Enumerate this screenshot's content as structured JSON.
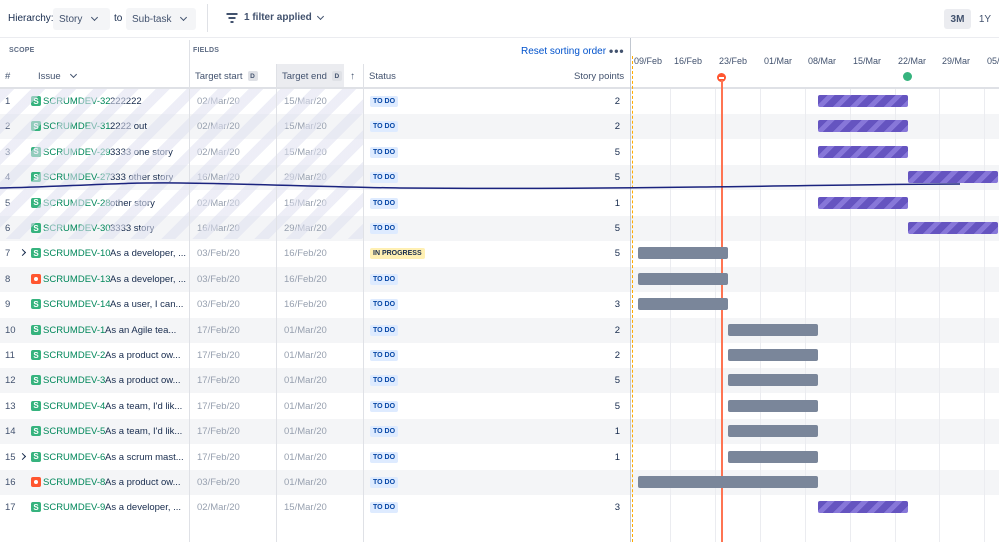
{
  "toolbar": {
    "hierarchy_label": "Hierarchy:",
    "from_value": "Story",
    "to_label": "to",
    "to_value": "Sub-task",
    "filter_label": "1 filter applied",
    "zoom_3m": "3M",
    "zoom_1y": "1Y"
  },
  "header": {
    "scope_label": "SCOPE",
    "fields_label": "FIELDS",
    "reset_sorting": "Reset sorting order",
    "more": "•••",
    "col_num": "#",
    "col_issue": "Issue",
    "col_target_start": "Target start",
    "col_target_end": "Target end",
    "col_status": "Status",
    "col_story_points": "Story points",
    "d_badge": "D",
    "sort_arrow": "↑"
  },
  "timeline": {
    "dates": [
      "09/Feb",
      "16/Feb",
      "23/Feb",
      "01/Mar",
      "08/Mar",
      "15/Mar",
      "22/Mar",
      "29/Mar",
      "05/"
    ]
  },
  "rows": [
    {
      "num": "1",
      "type": "story",
      "key": "SCRUMDEV-32",
      "summary": "222222",
      "start": "02/Mar/20",
      "end": "15/Mar/20",
      "status": "TO DO",
      "points": "2",
      "expand": false
    },
    {
      "num": "2",
      "type": "story",
      "key": "SCRUMDEV-31",
      "summary": "2222 out",
      "start": "02/Mar/20",
      "end": "15/Mar/20",
      "status": "TO DO",
      "points": "2",
      "expand": false
    },
    {
      "num": "3",
      "type": "story",
      "key": "SCRUMDEV-29",
      "summary": "3333 one story",
      "start": "02/Mar/20",
      "end": "15/Mar/20",
      "status": "TO DO",
      "points": "5",
      "expand": false
    },
    {
      "num": "4",
      "type": "story",
      "key": "SCRUMDEV-27",
      "summary": "333 other story",
      "start": "16/Mar/20",
      "end": "29/Mar/20",
      "status": "TO DO",
      "points": "5",
      "expand": false
    },
    {
      "num": "5",
      "type": "story",
      "key": "SCRUMDEV-28",
      "summary": "other story",
      "start": "02/Mar/20",
      "end": "15/Mar/20",
      "status": "TO DO",
      "points": "1",
      "expand": false
    },
    {
      "num": "6",
      "type": "story",
      "key": "SCRUMDEV-30",
      "summary": "3333 story",
      "start": "16/Mar/20",
      "end": "29/Mar/20",
      "status": "TO DO",
      "points": "5",
      "expand": false
    },
    {
      "num": "7",
      "type": "story",
      "key": "SCRUMDEV-10",
      "summary": "As a developer, ...",
      "start": "03/Feb/20",
      "end": "16/Feb/20",
      "status": "IN PROGRESS",
      "points": "5",
      "expand": true
    },
    {
      "num": "8",
      "type": "bug",
      "key": "SCRUMDEV-13",
      "summary": "As a developer, ...",
      "start": "03/Feb/20",
      "end": "16/Feb/20",
      "status": "TO DO",
      "points": "",
      "expand": false
    },
    {
      "num": "9",
      "type": "story",
      "key": "SCRUMDEV-14",
      "summary": "As a user, I can...",
      "start": "03/Feb/20",
      "end": "16/Feb/20",
      "status": "TO DO",
      "points": "3",
      "expand": false
    },
    {
      "num": "10",
      "type": "story",
      "key": "SCRUMDEV-1",
      "summary": "As an Agile tea...",
      "start": "17/Feb/20",
      "end": "01/Mar/20",
      "status": "TO DO",
      "points": "2",
      "expand": false
    },
    {
      "num": "11",
      "type": "story",
      "key": "SCRUMDEV-2",
      "summary": "As a product ow...",
      "start": "17/Feb/20",
      "end": "01/Mar/20",
      "status": "TO DO",
      "points": "2",
      "expand": false
    },
    {
      "num": "12",
      "type": "story",
      "key": "SCRUMDEV-3",
      "summary": "As a product ow...",
      "start": "17/Feb/20",
      "end": "01/Mar/20",
      "status": "TO DO",
      "points": "5",
      "expand": false
    },
    {
      "num": "13",
      "type": "story",
      "key": "SCRUMDEV-4",
      "summary": "As a team, I'd lik...",
      "start": "17/Feb/20",
      "end": "01/Mar/20",
      "status": "TO DO",
      "points": "5",
      "expand": false
    },
    {
      "num": "14",
      "type": "story",
      "key": "SCRUMDEV-5",
      "summary": "As a team, I'd lik...",
      "start": "17/Feb/20",
      "end": "01/Mar/20",
      "status": "TO DO",
      "points": "1",
      "expand": false
    },
    {
      "num": "15",
      "type": "story",
      "key": "SCRUMDEV-6",
      "summary": "As a scrum mast...",
      "start": "17/Feb/20",
      "end": "01/Mar/20",
      "status": "TO DO",
      "points": "1",
      "expand": true
    },
    {
      "num": "16",
      "type": "bug",
      "key": "SCRUMDEV-8",
      "summary": "As a product ow...",
      "start": "03/Feb/20",
      "end": "01/Mar/20",
      "status": "TO DO",
      "points": "",
      "expand": false
    },
    {
      "num": "17",
      "type": "story",
      "key": "SCRUMDEV-9",
      "summary": "As a developer, ...",
      "start": "02/Mar/20",
      "end": "15/Mar/20",
      "status": "TO DO",
      "points": "3",
      "expand": false
    }
  ],
  "icons": {
    "story": "S",
    "bar_arrow": "←"
  },
  "colors": {
    "accent": "#0052cc",
    "story": "#36b37e",
    "bug": "#ff5630",
    "today": "#ff7452",
    "bar_scheduled": "#6554c0",
    "bar_gray": "#7a869a",
    "ink_line": "#1a237e"
  }
}
